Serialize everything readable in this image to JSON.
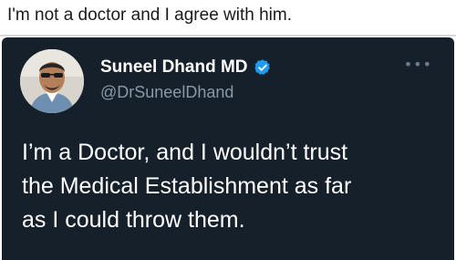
{
  "caption": "I'm not a doctor and I agree with him.",
  "tweet": {
    "display_name": "Suneel Dhand MD",
    "handle": "@DrSuneelDhand",
    "more_icon": "more-horizontal-icon",
    "verified_icon": "verified-badge-icon",
    "text_lines": [
      "I’m a Doctor, and I wouldn’t trust",
      "the Medical Establishment as far",
      "as I could throw them."
    ]
  },
  "colors": {
    "tweet_background": "#15202b",
    "verified_blue": "#1d9bf0",
    "handle_gray": "#8b98a5"
  }
}
